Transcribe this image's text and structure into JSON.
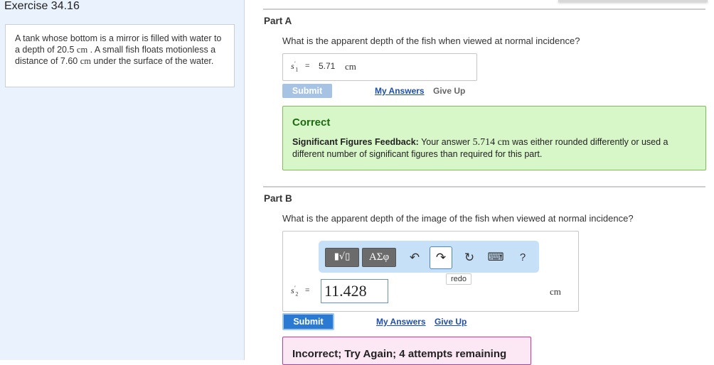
{
  "exercise": {
    "title": "Exercise 34.16",
    "problem": {
      "t1": "A tank whose bottom is a mirror is filled with water to a depth of 20.5",
      "u1": "cm",
      "t2": ". A small fish floats motionless a distance of 7.60",
      "u2": "cm",
      "t3": "under the surface of the water."
    }
  },
  "part_a": {
    "label": "Part A",
    "question": "What is the apparent depth of the fish when viewed at normal incidence?",
    "var": "s",
    "var_sub": "1",
    "prime": "′",
    "equals": "=",
    "value": "5.71",
    "unit": "cm",
    "submit_label": "Submit",
    "my_answers_label": "My Answers",
    "give_up_label": "Give Up",
    "feedback": {
      "title": "Correct",
      "sig_label": "Significant Figures Feedback:",
      "b1": " Your answer ",
      "answer": "5.714",
      "unit": "cm",
      "b2": " was either rounded differently or used a different number of significant figures than required for this part.",
      "color": "#d8f7c9"
    }
  },
  "part_b": {
    "label": "Part B",
    "question": "What is the apparent depth of the image of the fish when viewed at normal incidence?",
    "toolbar": {
      "templates_label": "▮√▯",
      "symbols_label": "ΑΣφ",
      "undo_glyph": "↶",
      "redo_glyph": "↷",
      "reset_glyph": "↻",
      "keyboard_glyph": "⌨",
      "help_glyph": "?",
      "tooltip": "redo"
    },
    "var": "s",
    "var_sub": "2",
    "prime": "′",
    "equals": "=",
    "value": "11.428",
    "unit": "cm",
    "submit_label": "Submit",
    "my_answers_label": "My Answers",
    "give_up_label": "Give Up",
    "feedback": {
      "title": "Incorrect; Try Again; 4 attempts remaining",
      "color": "#fce7f4"
    }
  }
}
